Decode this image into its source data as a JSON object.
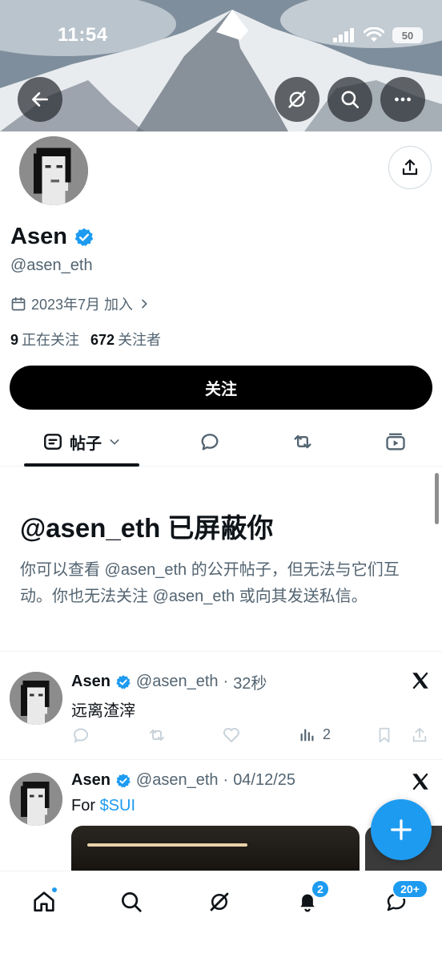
{
  "status_bar": {
    "time": "11:54",
    "battery": "50"
  },
  "profile": {
    "name": "Asen",
    "handle": "@asen_eth",
    "joined": "2023年7月 加入",
    "following_count": "9",
    "following_label": "正在关注",
    "followers_count": "672",
    "followers_label": "关注者",
    "follow_button": "关注"
  },
  "tabs": {
    "posts_label": "帖子"
  },
  "blocked": {
    "title": "@asen_eth 已屏蔽你",
    "body": "你可以查看 @asen_eth 的公开帖子，但无法与它们互动。你也无法关注 @asen_eth 或向其发送私信。"
  },
  "tweets": [
    {
      "name": "Asen",
      "handle": "@asen_eth",
      "time": "32秒",
      "text": "远离渣滓",
      "views": "2"
    },
    {
      "name": "Asen",
      "handle": "@asen_eth",
      "time": "04/12/25",
      "text_prefix": "For ",
      "cashtag": "$SUI"
    }
  ],
  "nav": {
    "notifications_badge": "2",
    "messages_badge": "20+"
  },
  "colors": {
    "accent": "#1d9bf0",
    "text": "#0f1419",
    "secondary": "#536471",
    "button_bg": "#000000"
  },
  "icons": {
    "back": "back-arrow-icon",
    "grok": "grok-icon",
    "search": "search-icon",
    "more": "more-icon",
    "share": "share-icon",
    "verified": "verified-badge-icon",
    "calendar": "calendar-icon",
    "posts": "posts-icon",
    "replies": "replies-icon",
    "reposts": "reposts-icon",
    "media": "media-icon",
    "x": "x-logo-icon",
    "compose": "compose-icon",
    "home": "home-icon",
    "notifications": "bell-icon",
    "messages": "messages-icon"
  }
}
